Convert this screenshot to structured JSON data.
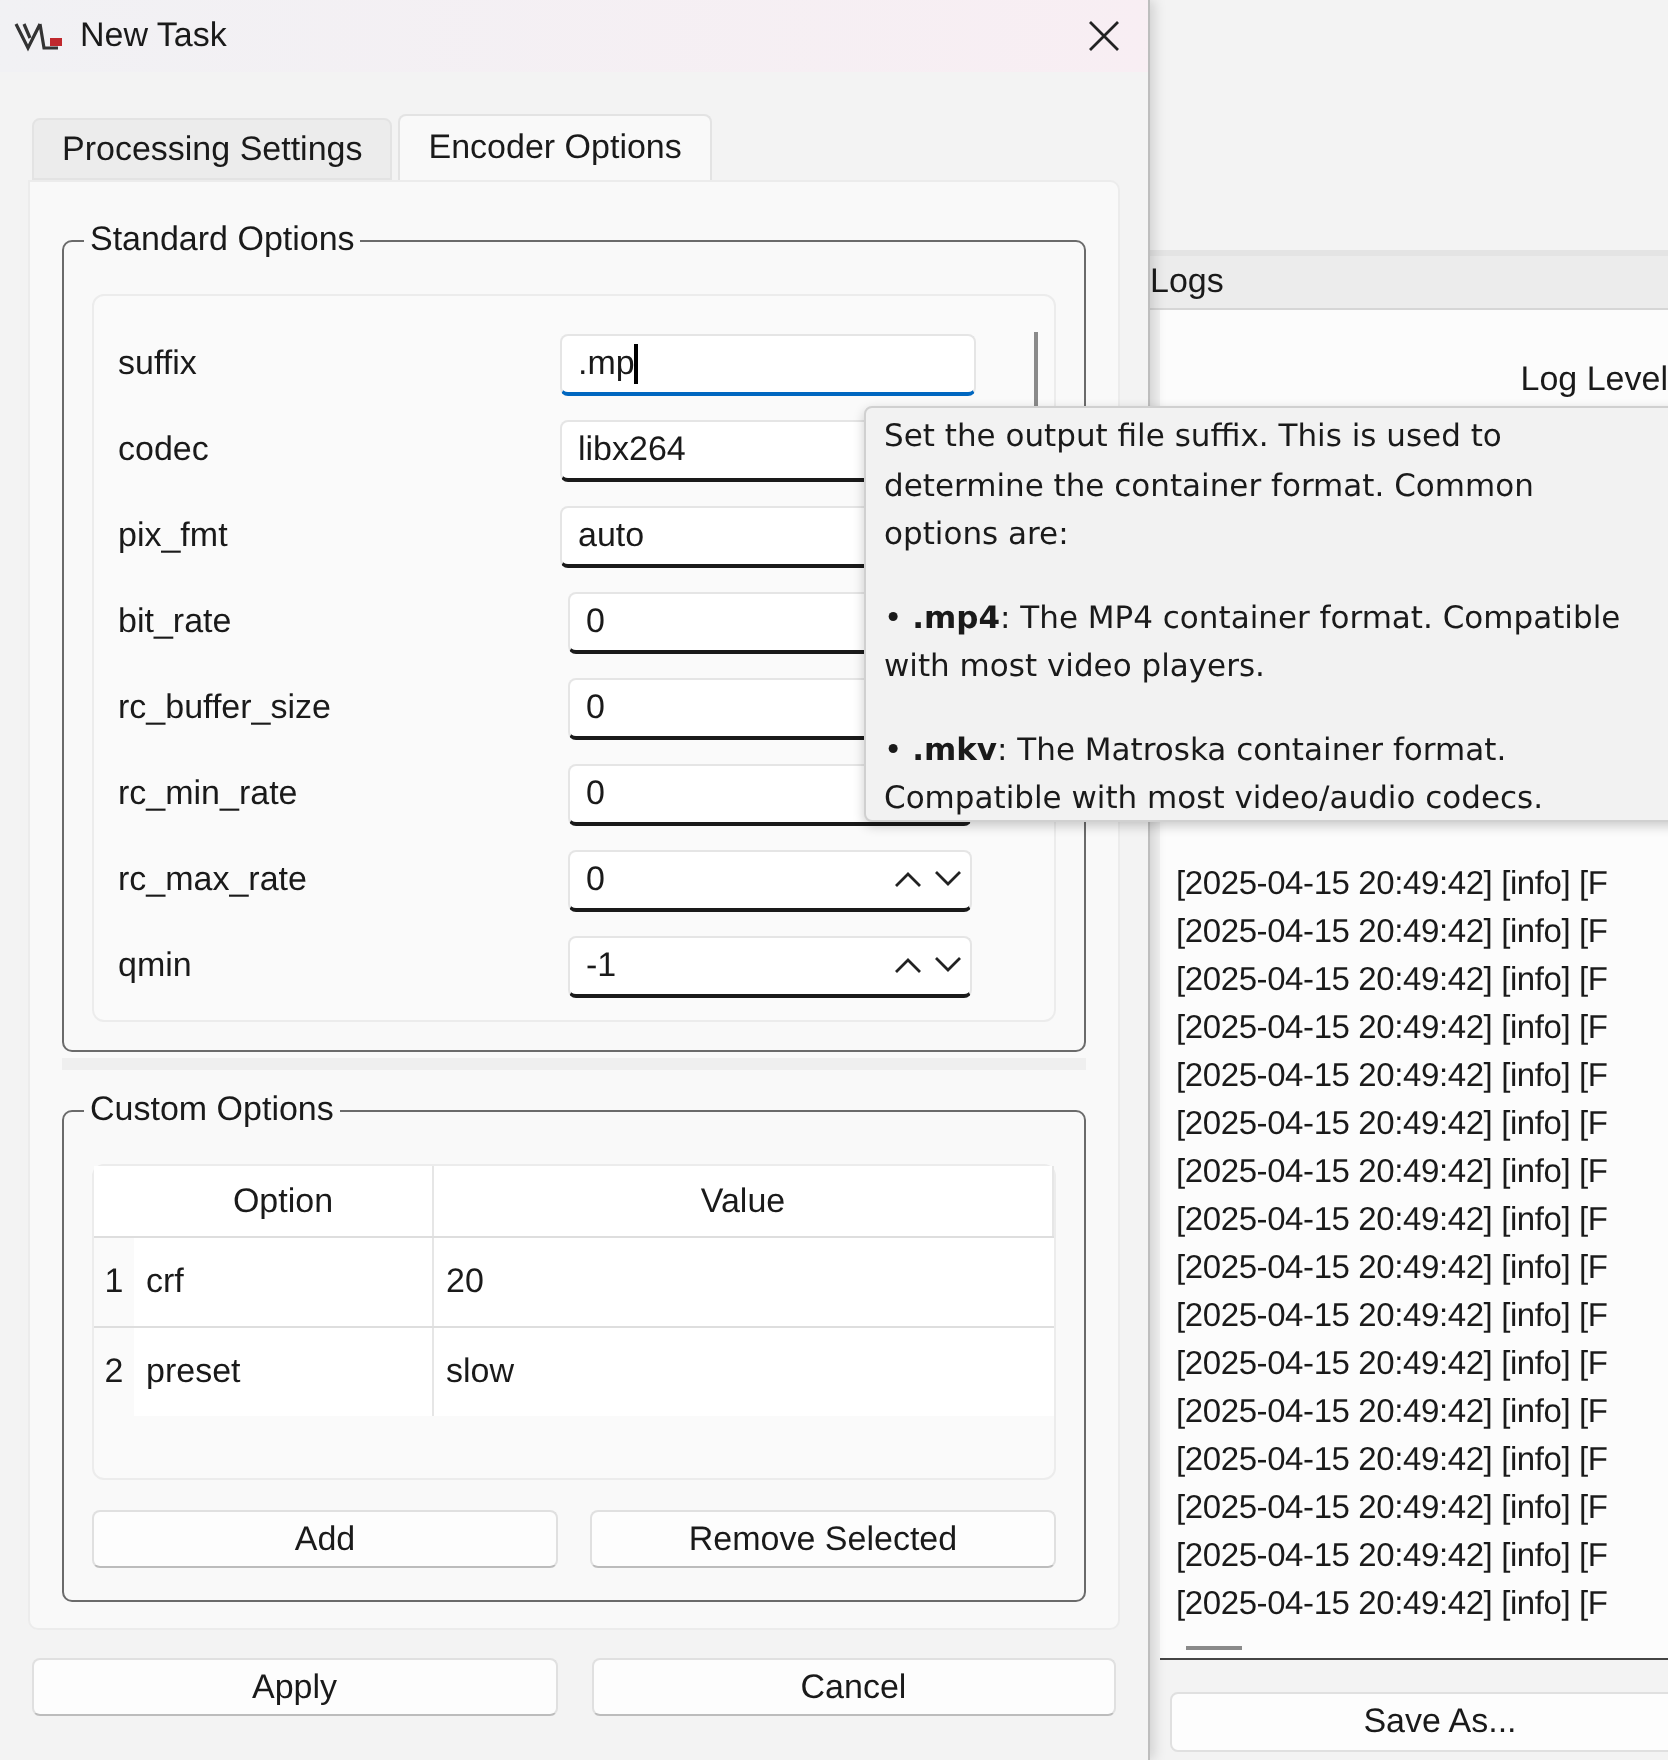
{
  "window": {
    "title": "New Task"
  },
  "tabs": [
    {
      "label": "Processing Settings",
      "selected": false
    },
    {
      "label": "Encoder Options",
      "selected": true
    }
  ],
  "standard_options": {
    "title": "Standard Options",
    "rows": [
      {
        "label": "suffix",
        "kind": "text",
        "value": ".mp",
        "focused": true
      },
      {
        "label": "codec",
        "kind": "text",
        "value": "libx264",
        "focused": false
      },
      {
        "label": "pix_fmt",
        "kind": "text",
        "value": "auto",
        "focused": false
      },
      {
        "label": "bit_rate",
        "kind": "spin",
        "value": "0",
        "focused": false
      },
      {
        "label": "rc_buffer_size",
        "kind": "spin",
        "value": "0",
        "focused": false
      },
      {
        "label": "rc_min_rate",
        "kind": "spin",
        "value": "0",
        "focused": false
      },
      {
        "label": "rc_max_rate",
        "kind": "spin",
        "value": "0",
        "focused": false
      },
      {
        "label": "qmin",
        "kind": "spin",
        "value": "-1",
        "focused": false
      }
    ]
  },
  "custom_options": {
    "title": "Custom Options",
    "columns": [
      "Option",
      "Value"
    ],
    "rows": [
      {
        "index": "1",
        "option": "crf",
        "value": "20"
      },
      {
        "index": "2",
        "option": "preset",
        "value": "slow"
      }
    ],
    "buttons": [
      "Add",
      "Remove Selected"
    ]
  },
  "dialog_buttons": [
    "Apply",
    "Cancel"
  ],
  "tooltip": {
    "paragraphs": [
      "Set the output file suffix. This is used to determine the container format. Common options are:",
      "• **.mp4**: The MP4 container format. Compatible with most video players.",
      "• **.mkv**: The Matroska container format. Compatible with most video/audio codecs."
    ]
  },
  "logs_panel": {
    "tab": "Logs",
    "log_level_label": "Log Level",
    "lines": [
      "[2025-04-15 20:49:42] [info] [F",
      "[2025-04-15 20:49:42] [info] [F",
      "[2025-04-15 20:49:42] [info] [F",
      "[2025-04-15 20:49:42] [info] [F",
      "[2025-04-15 20:49:42] [info] [F",
      "[2025-04-15 20:49:42] [info] [F",
      "[2025-04-15 20:49:42] [info] [F",
      "[2025-04-15 20:49:42] [info] [F",
      "[2025-04-15 20:49:42] [info] [F",
      "[2025-04-15 20:49:42] [info] [F",
      "[2025-04-15 20:49:42] [info] [F",
      "[2025-04-15 20:49:42] [info] [F",
      "[2025-04-15 20:49:42] [info] [F",
      "[2025-04-15 20:49:42] [info] [F",
      "[2025-04-15 20:49:42] [info] [F",
      "[2025-04-15 20:49:42] [info] [F"
    ],
    "save_button": "Save As..."
  }
}
